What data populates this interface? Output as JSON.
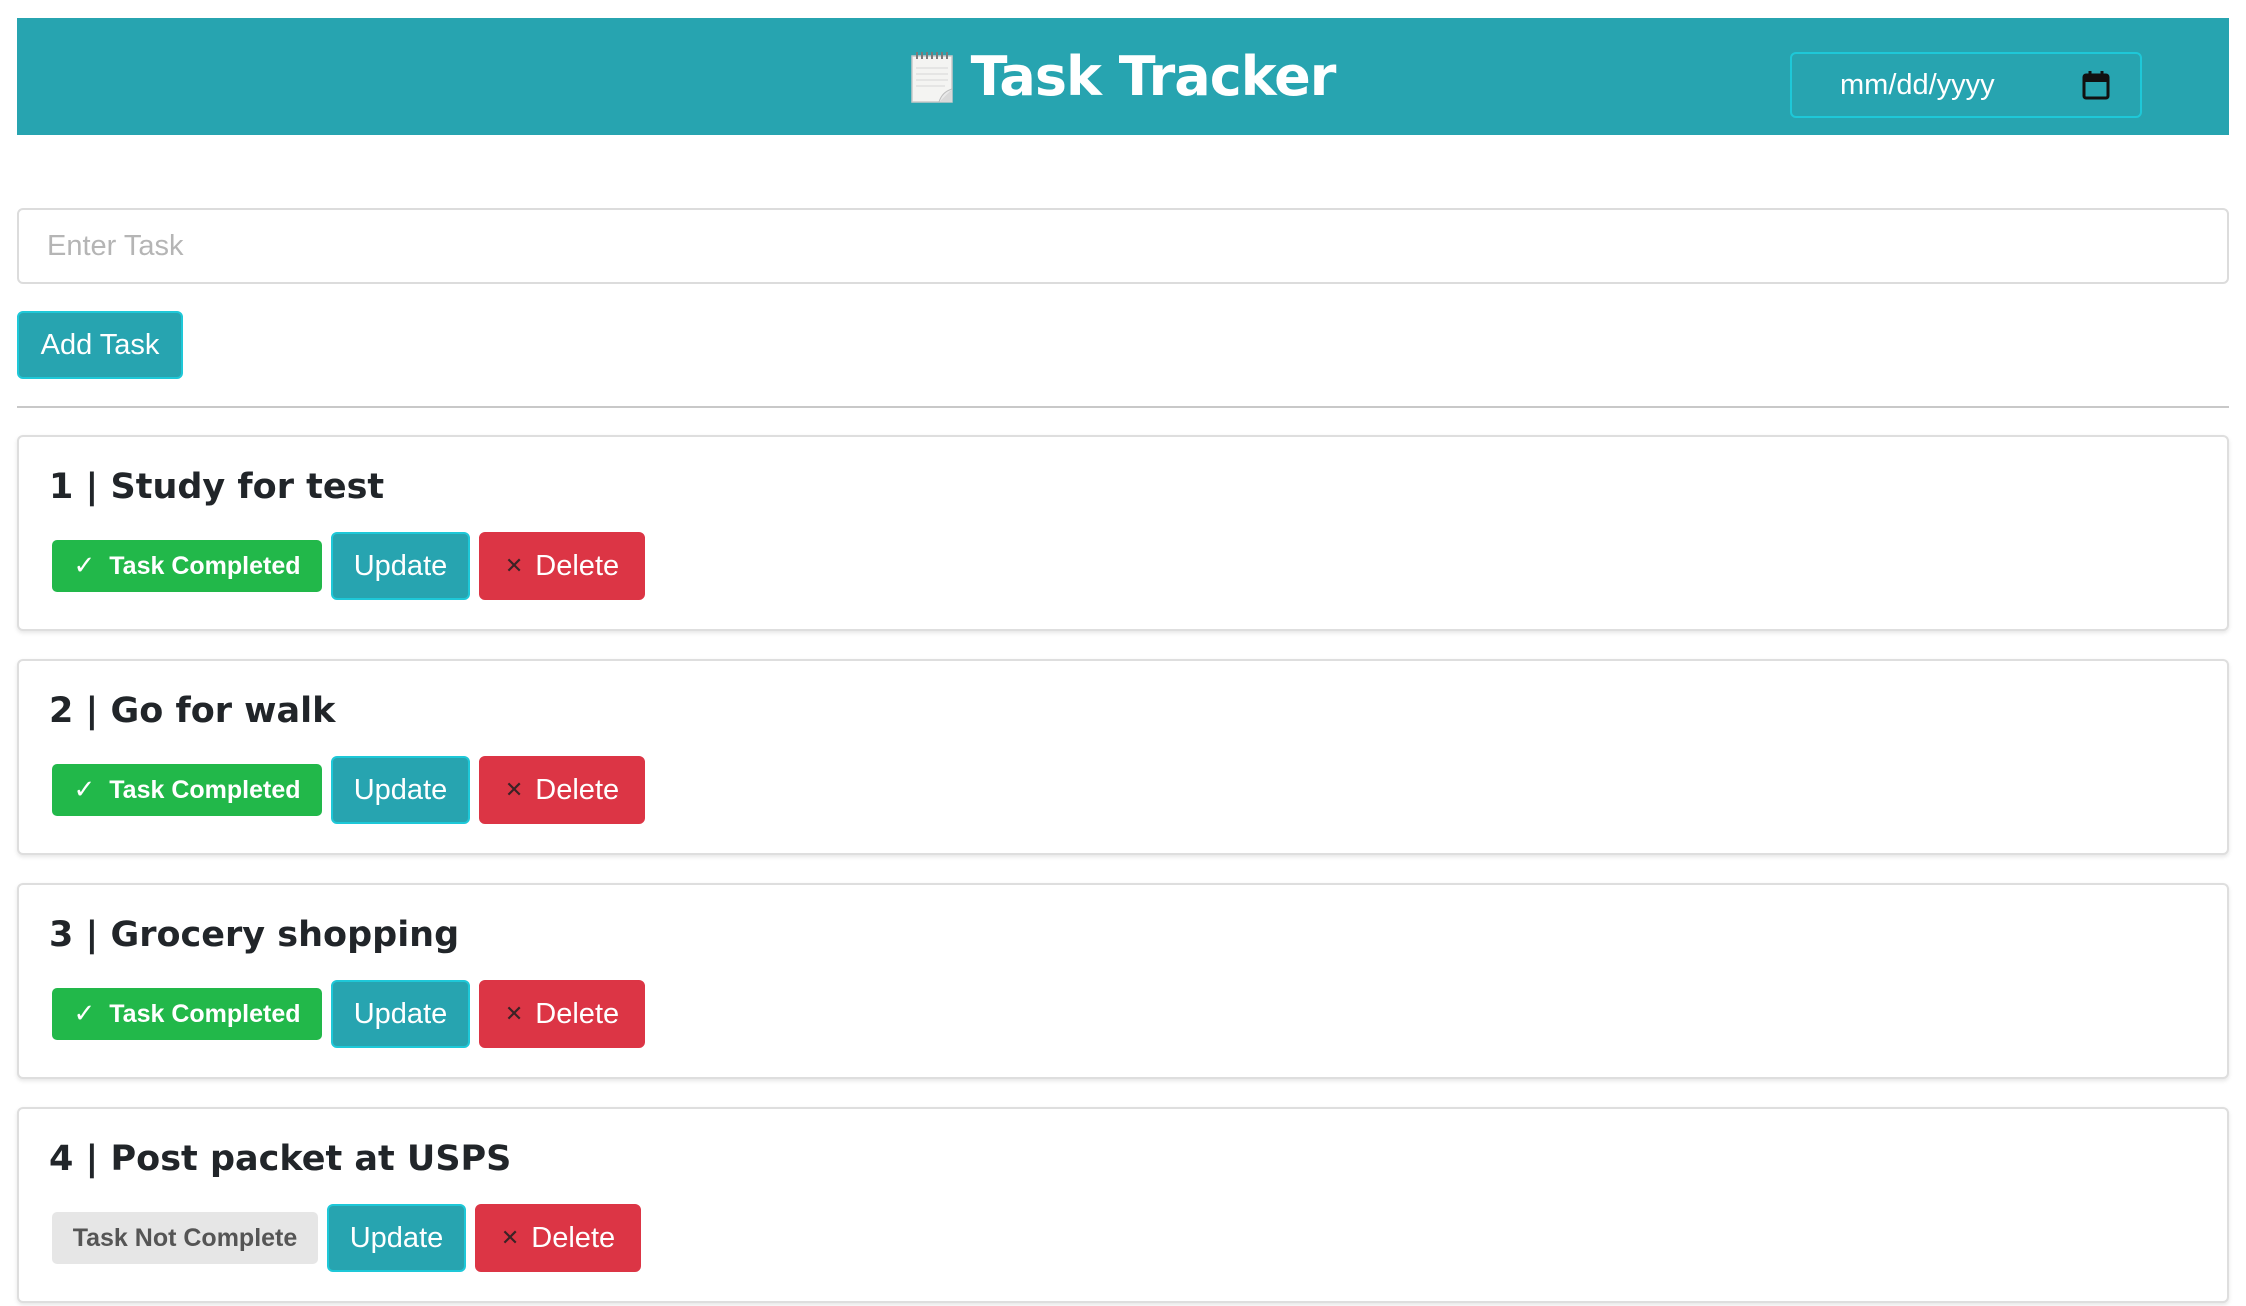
{
  "header": {
    "title": "Task Tracker",
    "icon": "notepad-icon",
    "date_placeholder": "mm/dd/yyyy",
    "calendar_icon": "calendar-icon"
  },
  "form": {
    "task_placeholder": "Enter Task",
    "task_value": "",
    "add_label": "Add Task"
  },
  "colors": {
    "header_bg": "#27a4b0",
    "completed": "#22b84a",
    "not_complete": "#e6e6e6",
    "delete": "#dc3545",
    "primary": "#27a4b0"
  },
  "tasks": [
    {
      "title": "1 | Study for test",
      "status": "Task Completed",
      "completed": true,
      "check": "✓",
      "update_label": "Update",
      "delete_label": "Delete",
      "delete_icon": "✕"
    },
    {
      "title": "2 | Go for walk",
      "status": "Task Completed",
      "completed": true,
      "check": "✓",
      "update_label": "Update",
      "delete_label": "Delete",
      "delete_icon": "✕"
    },
    {
      "title": "3 | Grocery shopping",
      "status": "Task Completed",
      "completed": true,
      "check": "✓",
      "update_label": "Update",
      "delete_label": "Delete",
      "delete_icon": "✕"
    },
    {
      "title": "4 | Post packet at USPS",
      "status": "Task Not Complete",
      "completed": false,
      "check": "",
      "update_label": "Update",
      "delete_label": "Delete",
      "delete_icon": "✕"
    }
  ]
}
